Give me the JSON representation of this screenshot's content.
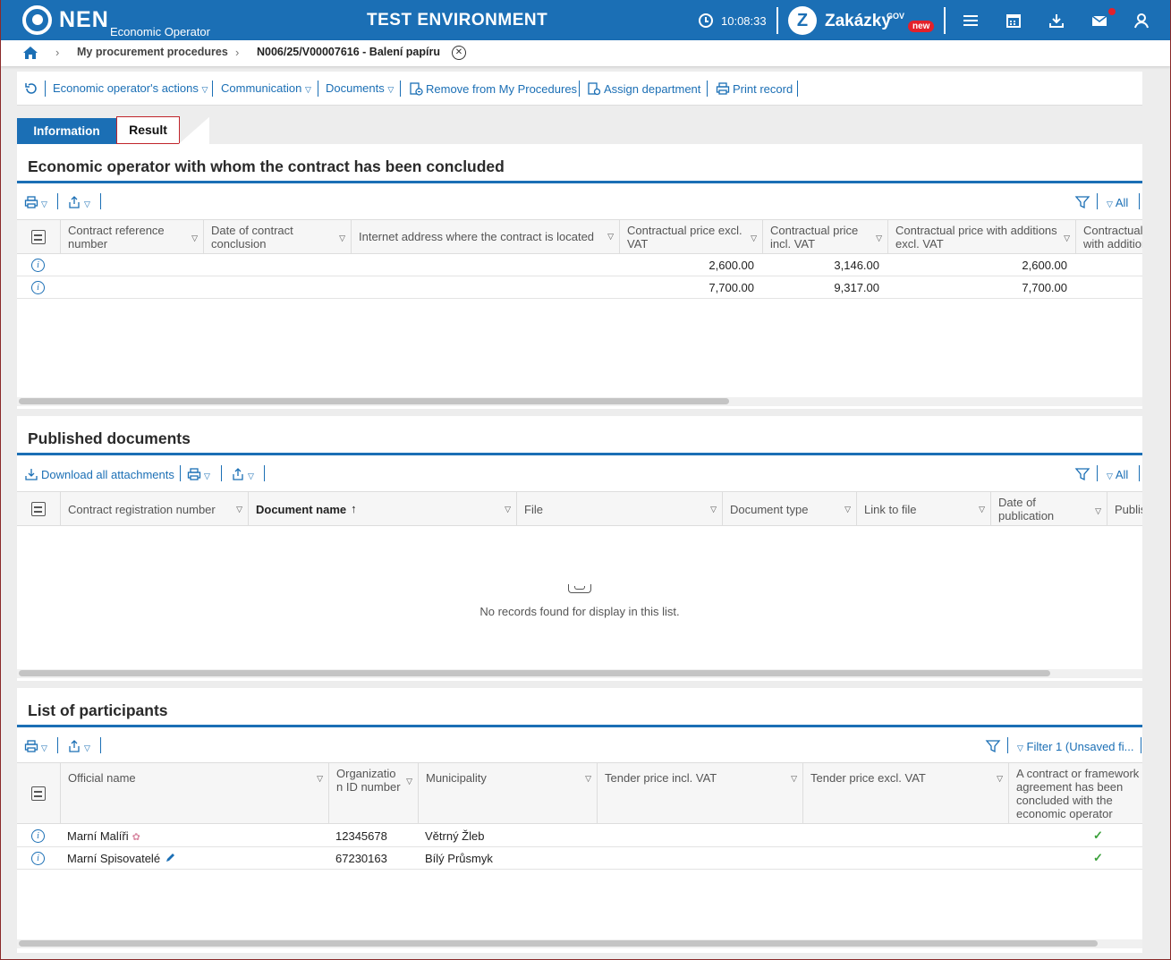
{
  "header": {
    "logo_text": "NEN",
    "logo_subtitle": "Economic Operator",
    "environment": "TEST ENVIRONMENT",
    "clock": "10:08:33",
    "zakazky_text": "Zakázky",
    "zakazky_gov": "GOV",
    "zakazky_badge": "new",
    "color_primary": "#1b6fb5",
    "color_badge": "#e3212b"
  },
  "breadcrumb": {
    "items": [
      "My procurement procedures"
    ],
    "current": "N006/25/V00007616 - Balení papíru"
  },
  "actions": [
    {
      "label": "Economic operator's actions",
      "dropdown": true
    },
    {
      "label": "Communication",
      "dropdown": true
    },
    {
      "label": "Documents",
      "dropdown": true
    },
    {
      "label": "Remove from My Procedures",
      "icon": "document-remove-icon"
    },
    {
      "label": "Assign department",
      "icon": "gear-assign-icon"
    },
    {
      "label": "Print record",
      "icon": "printer-icon"
    }
  ],
  "tabs": {
    "information": "Information",
    "result": "Result"
  },
  "contracts": {
    "title": "Economic operator with whom the contract has been concluded",
    "filter_all": "All",
    "columns": [
      "Contract reference number",
      "Date of contract conclusion",
      "Internet address where the contract is located",
      "Contractual price excl. VAT",
      "Contractual price incl. VAT",
      "Contractual price with additions excl. VAT",
      "Contractual price with additions incl. VAT"
    ],
    "rows": [
      {
        "ref": "",
        "date": "",
        "url": "",
        "price_excl": "2,600.00",
        "price_incl": "3,146.00",
        "add_excl": "2,600.00"
      },
      {
        "ref": "",
        "date": "",
        "url": "",
        "price_excl": "7,700.00",
        "price_incl": "9,317.00",
        "add_excl": "7,700.00"
      }
    ]
  },
  "documents": {
    "title": "Published documents",
    "download_all": "Download all attachments",
    "filter_all": "All",
    "columns": [
      "Contract registration number",
      "Document name",
      "File",
      "Document type",
      "Link to file",
      "Date of publication",
      "Publis"
    ],
    "empty_message": "No records found for display in this list."
  },
  "participants": {
    "title": "List of participants",
    "filter_label": "Filter 1 (Unsaved fi...",
    "columns": [
      "Official name",
      "Organization ID number",
      "Municipality",
      "Tender price incl. VAT",
      "Tender price excl. VAT",
      "A contract or framework agreement has been concluded with the economic operator"
    ],
    "rows": [
      {
        "name": "Marní Malíři",
        "org_id": "12345678",
        "municipality": "Větrný Žleb",
        "concluded": "✓"
      },
      {
        "name": "Marní Spisovatelé",
        "org_id": "67230163",
        "municipality": "Bílý Průsmyk",
        "concluded": "✓"
      }
    ]
  }
}
